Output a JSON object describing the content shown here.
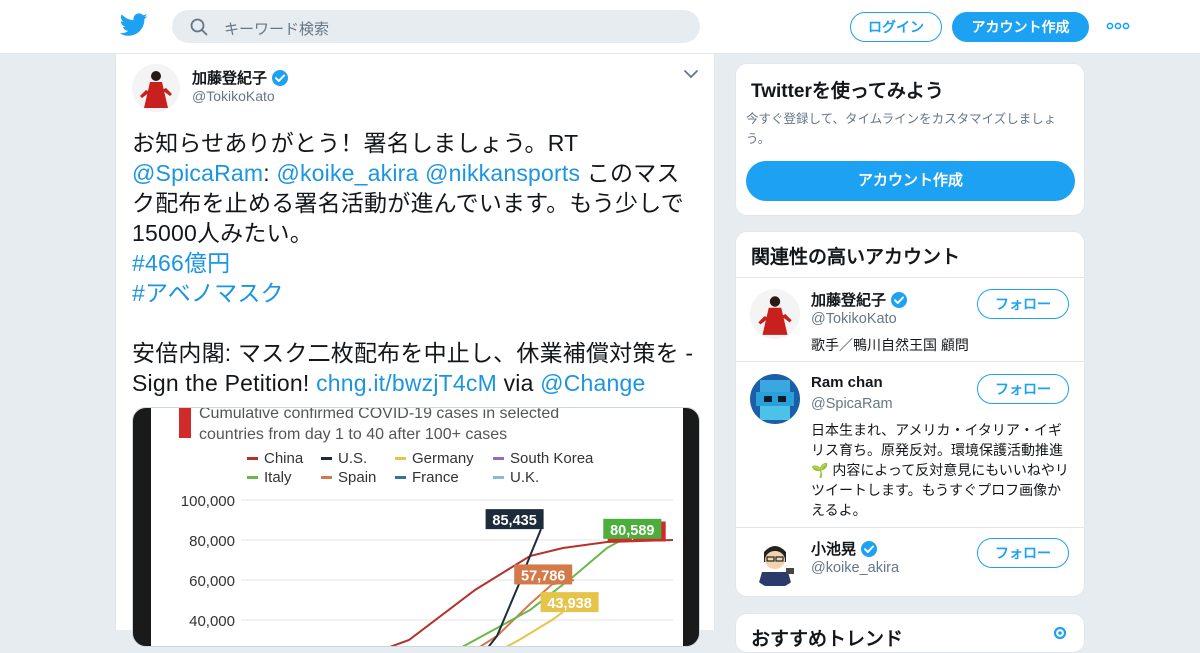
{
  "colors": {
    "accent": "#1da1f2",
    "link": "#1b95e0",
    "muted": "#657786",
    "background": "#e6ecf0"
  },
  "header": {
    "logo_icon": "twitter-bird-icon",
    "search_placeholder": "キーワード検索",
    "login_label": "ログイン",
    "signup_label": "アカウント作成",
    "more_icon": "more-dots-icon"
  },
  "tweet": {
    "name": "加藤登紀子",
    "handle": "@TokikoKato",
    "lines": {
      "l1": "お知らせありがとう！署名しましょう。RT",
      "m1": "@SpicaRam",
      "colon": ":",
      "m2": "@koike_akira",
      "m3": "@nikkansports",
      "l2tail": "このマス",
      "l3": "ク配布を止める署名活動が進んでいます。もう少しで",
      "l4": "15000人みたい。",
      "h1": "#466億円",
      "h2": "#アベノマスク",
      "l7": "安倍内閣: マスク二枚配布を中止し、休業補償対策を -",
      "l8": "Sign the Petition!",
      "url": "chng.it/bwzjT4cM",
      "via": "via",
      "m4": "@Change"
    },
    "chart_data": {
      "type": "line",
      "title": "Cumulative confirmed COVID-19 cases in selected countries from day 1 to 40 after 100+ cases",
      "legend": [
        "China",
        "U.S.",
        "Germany",
        "South Korea",
        "Italy",
        "Spain",
        "France",
        "U.K."
      ],
      "series_colors": {
        "China": "#b5312c",
        "U.S.": "#1d2b3a",
        "Germany": "#e6c44a",
        "South Korea": "#9a6bb5",
        "Italy": "#6bb84a",
        "Spain": "#d47a4a",
        "France": "#3e6f99",
        "U.K.": "#8fb8d8"
      },
      "y_ticks": [
        "100,000",
        "80,000",
        "60,000",
        "40,000"
      ],
      "ylim": [
        0,
        100000
      ],
      "labels": [
        {
          "series": "U.S.",
          "text": "85,435",
          "value": 85435
        },
        {
          "series": "China",
          "text": "79,251",
          "value": 79251
        },
        {
          "series": "Italy",
          "text": "80,589",
          "value": 80589
        },
        {
          "series": "Spain",
          "text": "57,786",
          "value": 57786
        },
        {
          "series": "Germany",
          "text": "43,938",
          "value": 43938
        }
      ]
    }
  },
  "sidebar": {
    "try": {
      "title": "Twitterを使ってみよう",
      "desc": "今すぐ登録して、タイムラインをカスタマイズしましょう。",
      "button": "アカウント作成"
    },
    "related": {
      "title": "関連性の高いアカウント",
      "follow_label": "フォロー",
      "accounts": [
        {
          "name": "加藤登紀子",
          "handle": "@TokikoKato",
          "bio": "歌手／鴨川自然王国 顧問"
        },
        {
          "name": "Ram chan",
          "handle": "@SpicaRam",
          "bio": "日本生まれ、アメリカ・イタリア・イギリス育ち。原発反対。環境保護活動推進🌱 内容によって反対意見にもいいねやリツイートします。もうすぐプロフ画像かえるよ。"
        },
        {
          "name": "小池晃",
          "handle": "@koike_akira",
          "bio": ""
        }
      ]
    },
    "trend": {
      "title": "おすすめトレンド",
      "icon": "gear-icon"
    }
  }
}
